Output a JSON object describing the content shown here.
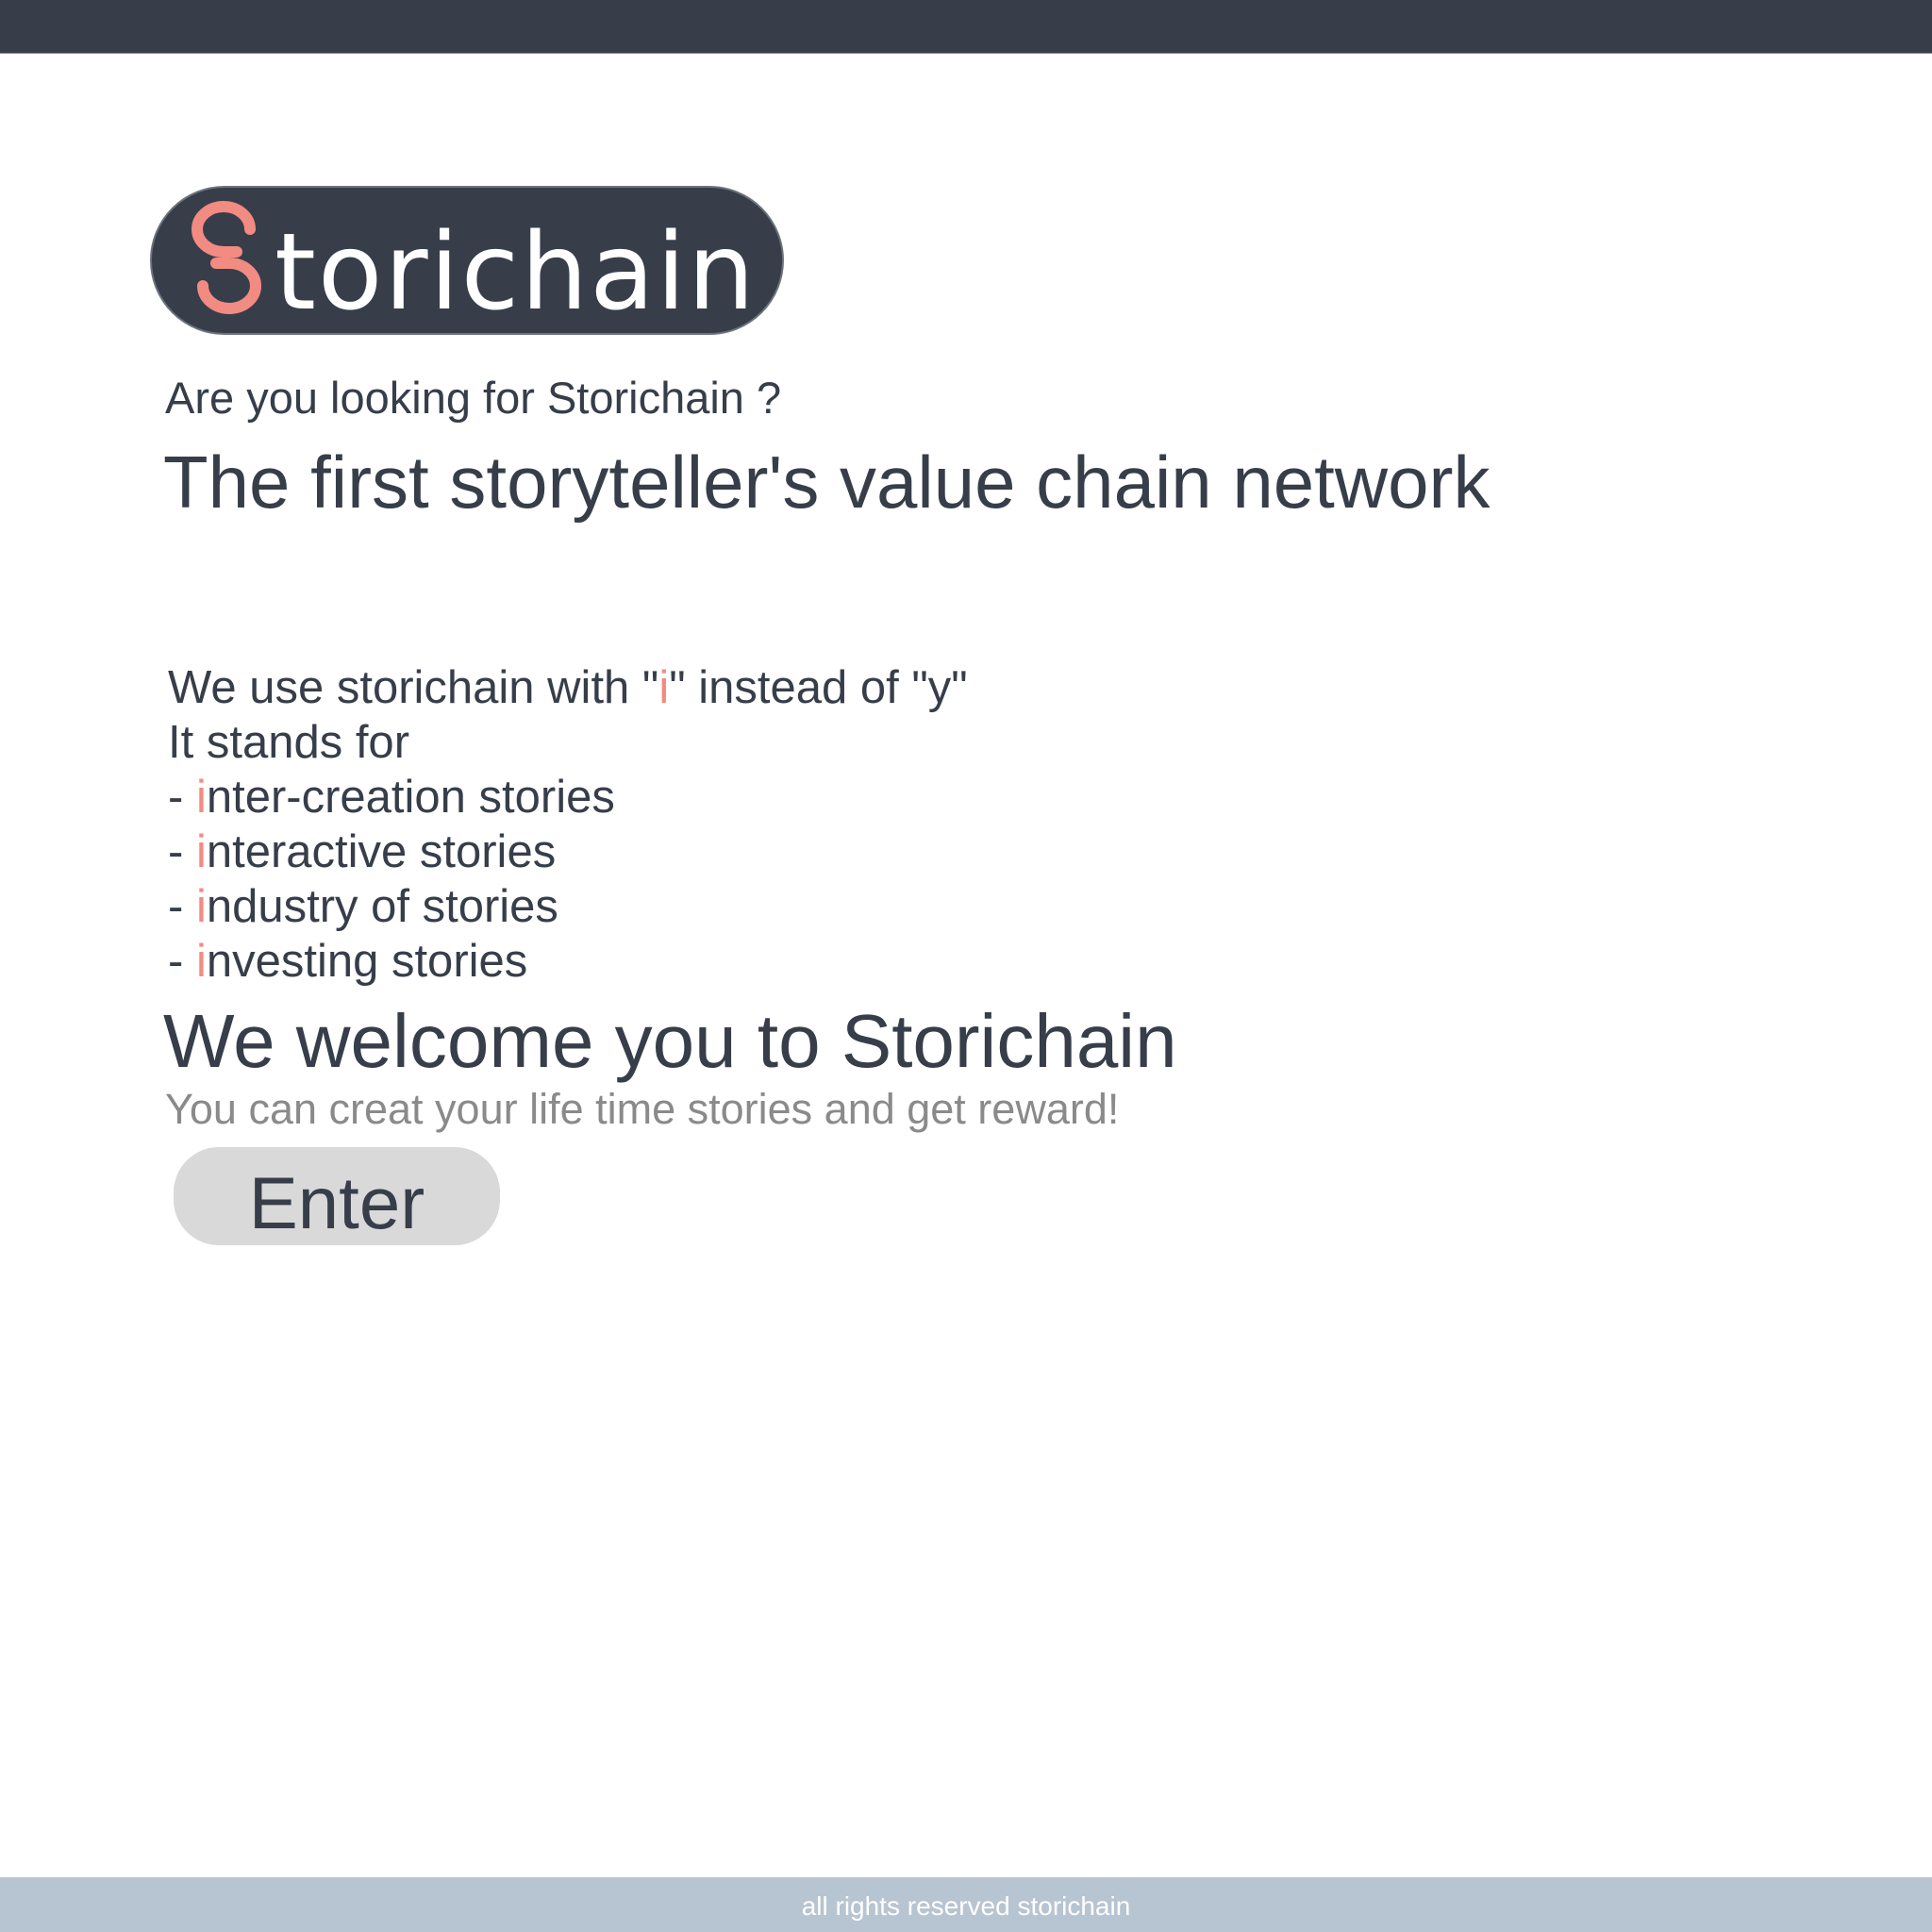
{
  "brand": {
    "logo_text": "Storichain",
    "logo_rest": "torichain",
    "accent_color": "#f28b82",
    "dark_color": "#373e4a"
  },
  "header": {
    "question": "Are you looking for Storichain ?",
    "tagline": "The first storyteller's value chain network"
  },
  "explanation": {
    "line1": {
      "before": "We use storichain with \"",
      "highlight": "i",
      "after": "\" instead of \"y\""
    },
    "line2": "It stands for",
    "items": [
      {
        "prefix": "- ",
        "highlight": "i",
        "rest": "nter-creation stories"
      },
      {
        "prefix": "- ",
        "highlight": "i",
        "rest": "nteractive stories"
      },
      {
        "prefix": "- ",
        "highlight": "i",
        "rest": "ndustry of stories"
      },
      {
        "prefix": "- ",
        "highlight": "i",
        "rest": "nvesting stories"
      }
    ]
  },
  "welcome": {
    "title": "We welcome you to Storichain",
    "subtitle": "You can creat your life time stories and get reward!",
    "enter_label": "Enter"
  },
  "footer": {
    "text": "all rights reserved storichain"
  }
}
